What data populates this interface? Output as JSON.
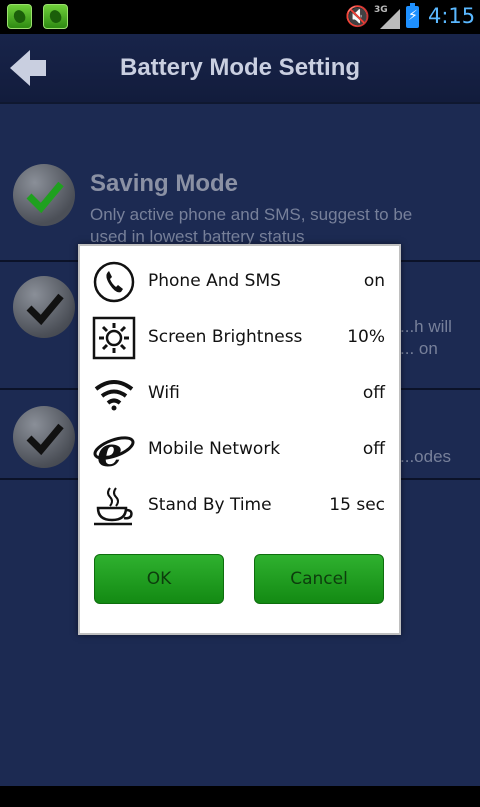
{
  "status_bar": {
    "time": "4:15",
    "network": "3G",
    "icons": [
      "app-icon",
      "app-icon",
      "mute-icon",
      "signal-icon",
      "battery-charging-icon"
    ]
  },
  "header": {
    "title": "Battery Mode Setting",
    "back_icon": "arrow-left-icon"
  },
  "list": {
    "items": [
      {
        "title": "Saving Mode",
        "description": "Only active phone and SMS, suggest to be used in lowest battery status"
      },
      {
        "title": "",
        "description": "...h will ... on"
      },
      {
        "title": "",
        "description": "...odes"
      }
    ]
  },
  "dialog": {
    "rows": [
      {
        "label": "Phone And SMS",
        "value": "on",
        "icon": "phone-icon"
      },
      {
        "label": "Screen Brightness",
        "value": "10%",
        "icon": "brightness-icon"
      },
      {
        "label": "Wifi",
        "value": "off",
        "icon": "wifi-icon"
      },
      {
        "label": "Mobile Network",
        "value": "off",
        "icon": "mobile-network-icon"
      },
      {
        "label": "Stand By Time",
        "value": "15 sec",
        "icon": "coffee-cup-icon"
      }
    ],
    "ok_label": "OK",
    "cancel_label": "Cancel"
  },
  "colors": {
    "background": "#1c2a52",
    "accent_green": "#1fa01f",
    "time_blue": "#5ab8ff"
  }
}
